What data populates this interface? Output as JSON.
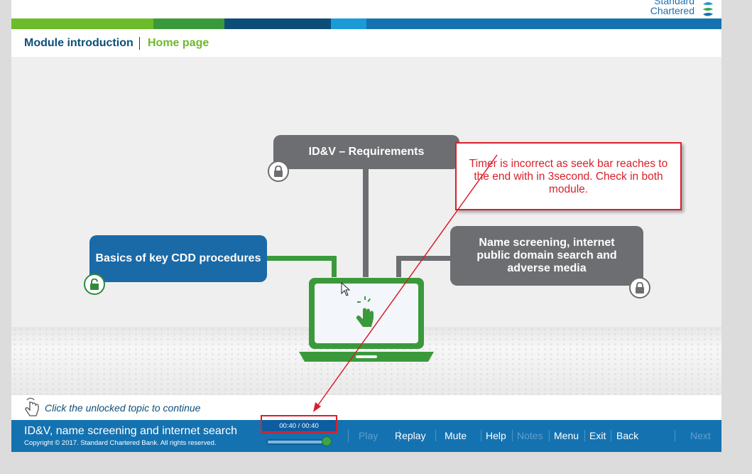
{
  "brand": {
    "name_line1": "Standard",
    "name_line2": "Chartered"
  },
  "stripe_colors": [
    "#6cbb2a",
    "#3a9a3b",
    "#0d4e78",
    "#1a9ad6",
    "#1572b0"
  ],
  "nav": {
    "module_intro": "Module introduction",
    "home_page": "Home page"
  },
  "topics": {
    "requirements": "ID&V – Requirements",
    "cdd": "Basics of key CDD procedures",
    "name_screening": "Name screening, internet public domain search and adverse media"
  },
  "annotation": {
    "text": "Timer is incorrect as seek bar reaches to the end with in 3second. Check in both module."
  },
  "instruction": "Click the unlocked topic to continue",
  "footer": {
    "title": "ID&V, name screening and internet search",
    "copyright": "Copyright © 2017. Standard Chartered Bank. All rights reserved.",
    "timer": "00:40 / 00:40",
    "seek_fraction": 1.0,
    "buttons": {
      "play": "Play",
      "replay": "Replay",
      "mute": "Mute",
      "help": "Help",
      "notes": "Notes",
      "menu": "Menu",
      "exit": "Exit",
      "back": "Back",
      "next": "Next"
    }
  },
  "colors": {
    "accent_green": "#6cbb2a",
    "brand_blue": "#1572b0",
    "annotation_red": "#d9202a",
    "locked_gray": "#6d6e71"
  }
}
